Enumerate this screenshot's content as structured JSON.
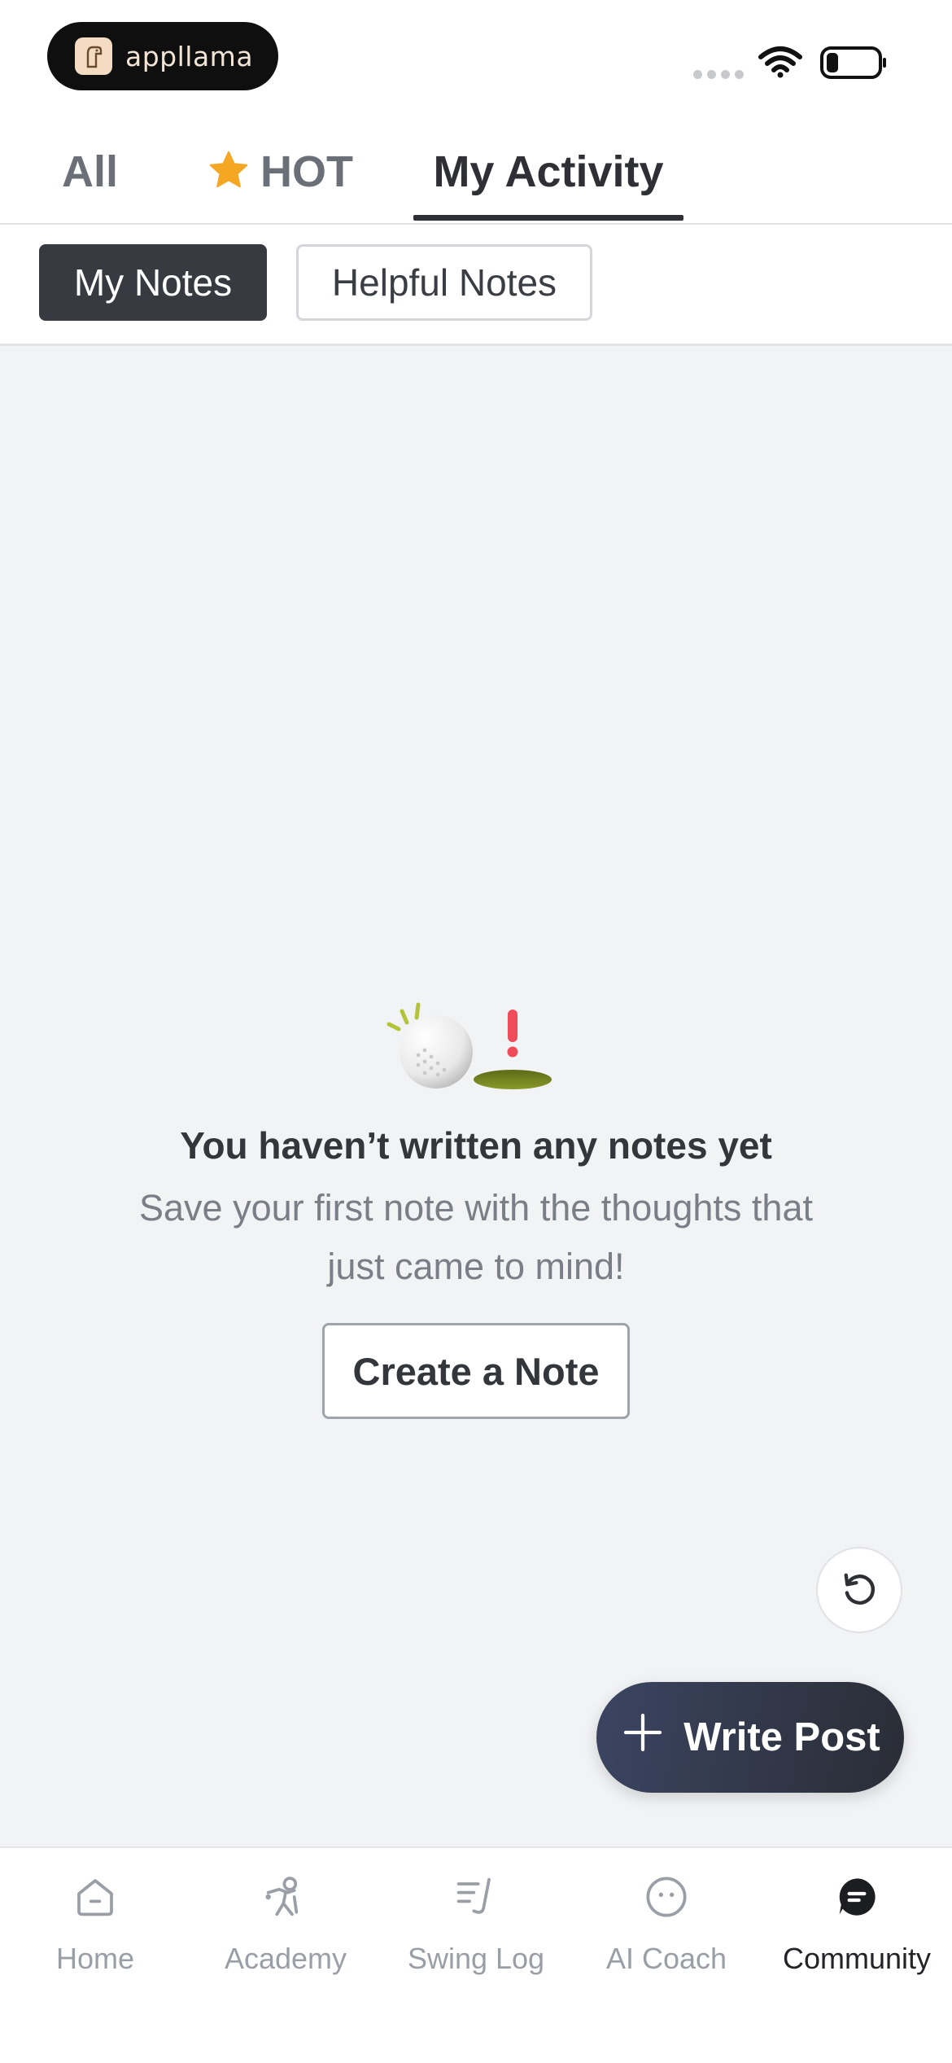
{
  "status_bar": {
    "brand_name": "appllama",
    "wifi_icon": "wifi-icon",
    "battery_icon": "battery-icon"
  },
  "tabs": {
    "all": "All",
    "hot": "HOT",
    "hot_icon": "star-icon",
    "my_activity": "My Activity",
    "active": "My Activity"
  },
  "subtabs": {
    "my_notes": "My Notes",
    "helpful_notes": "Helpful Notes",
    "active": "My Notes"
  },
  "empty_state": {
    "illustration": "golf-ball-hole-icon",
    "title": "You haven’t written any notes yet",
    "description_line1": "Save your first note with the thoughts that",
    "description_line2": "just came to mind!",
    "button": "Create a Note"
  },
  "floating": {
    "refresh_icon": "refresh-icon",
    "write_post": "Write Post"
  },
  "bottom_nav": {
    "items": [
      {
        "label": "Home",
        "icon": "home-icon"
      },
      {
        "label": "Academy",
        "icon": "academy-icon"
      },
      {
        "label": "Swing Log",
        "icon": "swing-log-icon"
      },
      {
        "label": "AI Coach",
        "icon": "ai-coach-icon"
      },
      {
        "label": "Community",
        "icon": "community-icon"
      }
    ],
    "active": "Community"
  },
  "colors": {
    "accent_dark": "#2e3035",
    "star": "#f5a623",
    "write_button": "#3b4562"
  }
}
